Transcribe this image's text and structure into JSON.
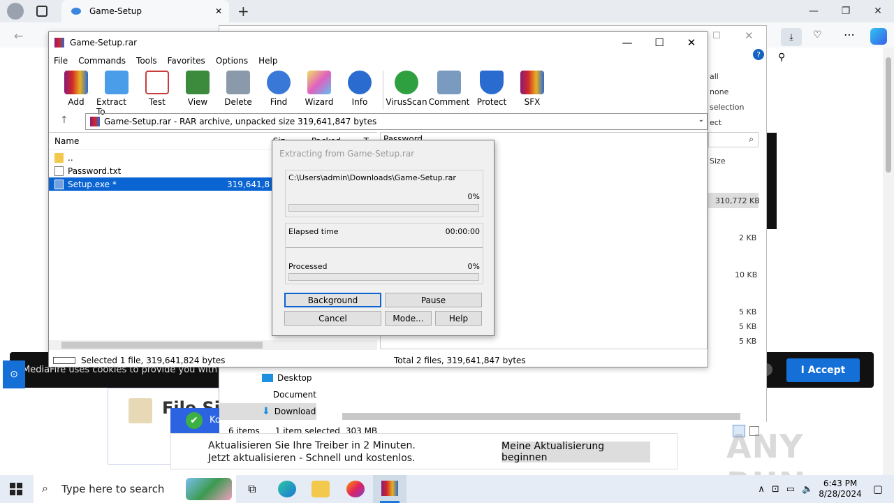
{
  "browser": {
    "tab_title": "Game-Setup",
    "new_tab": "+",
    "minimize": "—",
    "maximize": "❐",
    "close": "✕"
  },
  "webpage": {
    "cookie_text": "MediaFire uses cookies to provide you with a per",
    "accept_label": "I Accept",
    "ad_line1": "Aktualisieren Sie Ihre Treiber in 2 Minuten.",
    "ad_line2": "Jetzt aktualisieren - Schnell und kostenlos.",
    "ad_button": "Meine Aktualisierung beginnen",
    "partial_heading": "File Si",
    "notif_text": "Ko"
  },
  "explorer": {
    "nav": [
      "Desktop",
      "Document",
      "Download"
    ],
    "right_labels": [
      "all",
      "none",
      "selection",
      "ect"
    ],
    "size_header": "Size",
    "sizes": [
      "310,772 KB",
      "2 KB",
      "10 KB",
      "5 KB",
      "5 KB",
      "5 KB"
    ],
    "status_items": "6 items",
    "status_selected": "1 item selected",
    "status_size": "303 MB"
  },
  "winrar": {
    "title": "Game-Setup.rar",
    "menu": [
      "File",
      "Commands",
      "Tools",
      "Favorites",
      "Options",
      "Help"
    ],
    "tools": [
      "Add",
      "Extract To",
      "Test",
      "View",
      "Delete",
      "Find",
      "Wizard",
      "Info",
      "VirusScan",
      "Comment",
      "Protect",
      "SFX"
    ],
    "address": "Game-Setup.rar - RAR archive, unpacked size 319,641,847 bytes",
    "columns": {
      "name": "Name",
      "size": "Siz",
      "packed": "Packed",
      "type": "T"
    },
    "files": [
      {
        "name": "..",
        "size": ""
      },
      {
        "name": "Password.txt",
        "size": ""
      },
      {
        "name": "Setup.exe *",
        "size": "319,641,8"
      }
    ],
    "comment_preview": "Password",
    "status_left": "Selected 1 file, 319,641,824 bytes",
    "status_right": "Total 2 files, 319,641,847 bytes"
  },
  "extract_dialog": {
    "title": "Extracting from Game-Setup.rar",
    "path": "C:\\Users\\admin\\Downloads\\Game-Setup.rar",
    "file_percent": "0%",
    "elapsed_label": "Elapsed time",
    "elapsed_value": "00:00:00",
    "processed_label": "Processed",
    "processed_percent": "0%",
    "progress_fraction": 0,
    "buttons": {
      "background": "Background",
      "pause": "Pause",
      "cancel": "Cancel",
      "mode": "Mode...",
      "help": "Help"
    }
  },
  "taskbar": {
    "search_placeholder": "Type here to search",
    "time": "6:43 PM",
    "date": "8/28/2024"
  },
  "watermark": "ANY RUN"
}
